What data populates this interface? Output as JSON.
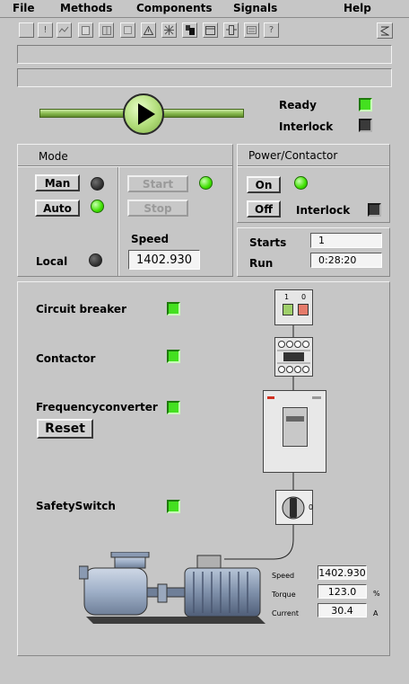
{
  "menubar": {
    "file": "File",
    "methods": "Methods",
    "components": "Components",
    "signals": "Signals",
    "help": "Help"
  },
  "toolbar": {
    "icons": [
      "blank-icon",
      "exclamation-icon",
      "trend-icon",
      "document-icon",
      "grid-icon",
      "blank-icon",
      "warning-icon",
      "crosshair-icon",
      "blocks-icon",
      "window-icon",
      "connector-icon",
      "list-icon",
      "help-icon"
    ],
    "help_glyph": "?",
    "exclaim_glyph": "!",
    "right_icon": "signal-icon"
  },
  "status": {
    "ready": "Ready",
    "interlock": "Interlock"
  },
  "mode": {
    "title": "Mode",
    "man": "Man",
    "auto": "Auto",
    "start": "Start",
    "stop": "Stop",
    "local": "Local",
    "speed_label": "Speed",
    "speed_value": "1402.930"
  },
  "power": {
    "title": "Power/Contactor",
    "on": "On",
    "off": "Off",
    "interlock": "Interlock"
  },
  "counters": {
    "starts_label": "Starts",
    "starts_value": "1",
    "run_label": "Run",
    "run_value": "0:28:20"
  },
  "components": {
    "circuit_breaker": "Circuit breaker",
    "contactor": "Contactor",
    "frequency_converter": "Frequencyconverter",
    "reset": "Reset",
    "safety_switch": "SafetySwitch",
    "breaker_one": "1",
    "breaker_zero": "0",
    "switch_zero": "0"
  },
  "motor": {
    "speed_label": "Speed",
    "speed_value": "1402.930",
    "torque_label": "Torque",
    "torque_value": "123.0",
    "torque_unit": "%",
    "current_label": "Current",
    "current_value": "30.4",
    "current_unit": "A"
  }
}
